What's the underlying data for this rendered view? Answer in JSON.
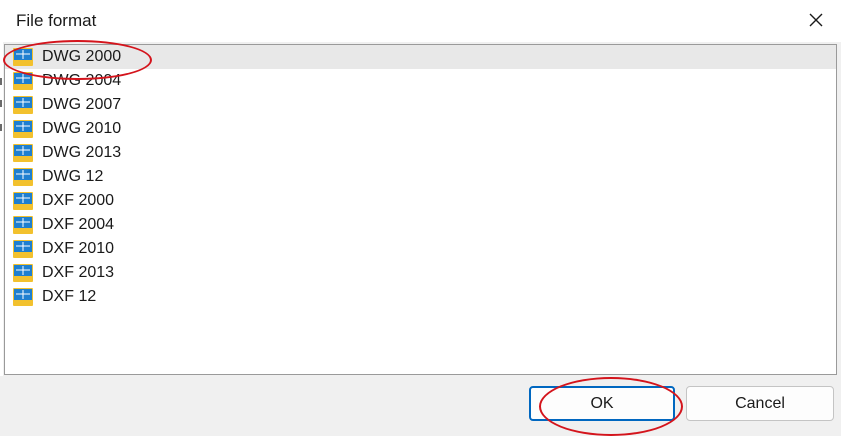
{
  "dialog": {
    "title": "File format",
    "close_icon": "close-icon"
  },
  "formats": [
    {
      "label": "DWG 2000",
      "icon": "dwg-file-icon",
      "selected": true
    },
    {
      "label": "DWG 2004",
      "icon": "dwg-file-icon"
    },
    {
      "label": "DWG 2007",
      "icon": "dwg-file-icon"
    },
    {
      "label": "DWG 2010",
      "icon": "dwg-file-icon"
    },
    {
      "label": "DWG 2013",
      "icon": "dwg-file-icon"
    },
    {
      "label": "DWG 12",
      "icon": "dwg-file-icon"
    },
    {
      "label": "DXF 2000",
      "icon": "dwg-file-icon"
    },
    {
      "label": "DXF 2004",
      "icon": "dwg-file-icon"
    },
    {
      "label": "DXF 2010",
      "icon": "dwg-file-icon"
    },
    {
      "label": "DXF 2013",
      "icon": "dwg-file-icon"
    },
    {
      "label": "DXF 12",
      "icon": "dwg-file-icon"
    }
  ],
  "buttons": {
    "ok_label": "OK",
    "cancel_label": "Cancel"
  },
  "colors": {
    "accent": "#0067c0",
    "annotation": "#d4141c",
    "selection": "#e8e8e8",
    "icon_blue": "#1e7fd0",
    "icon_yellow": "#f2c12e"
  }
}
